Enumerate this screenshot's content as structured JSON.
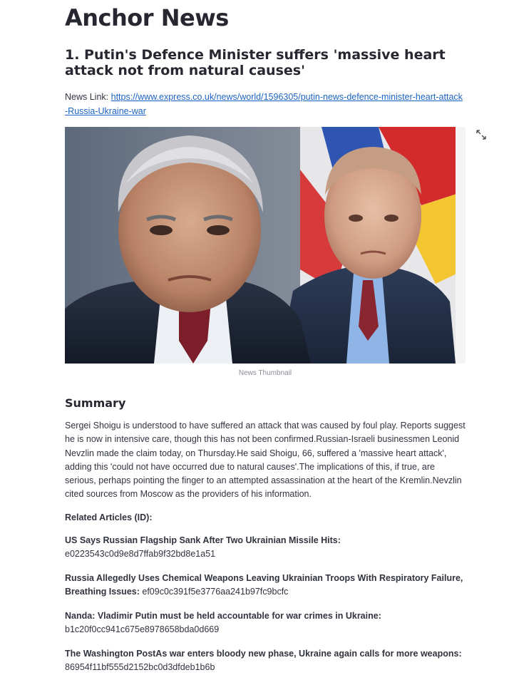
{
  "app": {
    "title": "Anchor News"
  },
  "article": {
    "headline": "1. Putin's Defence Minister suffers 'massive heart attack not from natural causes'",
    "link_label": "News Link:",
    "link_url": "https://www.express.co.uk/news/world/1596305/putin-news-defence-minister-heart-attack-Russia-Ukraine-war",
    "thumbnail_caption": "News Thumbnail",
    "expand_icon": "expand-arrows-icon"
  },
  "summary": {
    "title": "Summary",
    "text": "Sergei Shoigu is understood to have suffered an attack that was caused by foul play. Reports suggest he is now in intensive care, though this has not been confirmed.Russian-Israeli businessmen Leonid Nevzlin made the claim today, on Thursday.He said Shoigu, 66, suffered a 'massive heart attack', adding this 'could not have occurred due to natural causes'.The implications of this, if true, are serious, perhaps pointing the finger to an attempted assassination at the heart of the Kremlin.Nevzlin cited sources from Moscow as the providers of his information."
  },
  "related": {
    "title": "Related Articles (ID):",
    "items": [
      {
        "title": "US Says Russian Flagship Sank After Two Ukrainian Missile Hits:",
        "id": "e0223543c0d9e8d7ffab9f32bd8e1a51"
      },
      {
        "title": "Russia Allegedly Uses Chemical Weapons Leaving Ukrainian Troops With Respiratory Failure, Breathing Issues:",
        "id": "ef09c0c391f5e3776aa241b97fc9bcfc"
      },
      {
        "title": "Nanda: Vladimir Putin must be held accountable for war crimes in Ukraine:",
        "id": "b1c20f0cc941c675e8978658bda0d669"
      },
      {
        "title": "The Washington PostAs war enters bloody new phase, Ukraine again calls for more weapons:",
        "id": "86954f11bf555d2152bc0d3dfdeb1b6b"
      }
    ]
  },
  "colors": {
    "link": "#1c64c4",
    "text": "#31333f",
    "heading": "#262730",
    "caption": "#8b8d96"
  }
}
